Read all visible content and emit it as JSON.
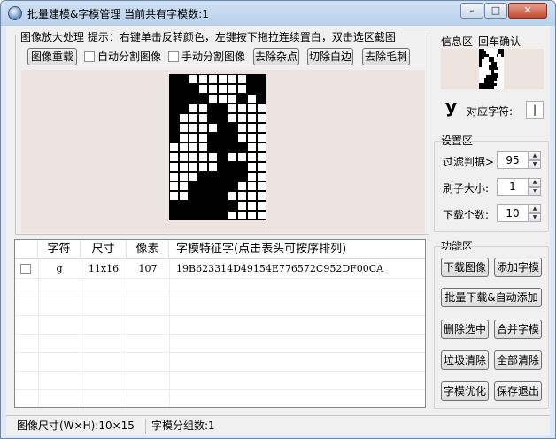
{
  "window": {
    "title": "批量建模&字模管理  当前共有字模数:1",
    "min_glyph": "–",
    "max_glyph": "□",
    "close_glyph": "✕"
  },
  "zoom": {
    "legend": "图像放大处理  提示：右键单击反转颜色，左键按下拖拉连续置白，双击选区截图",
    "reload_label": "图像重载",
    "auto_split_label": "自动分割图像",
    "manual_split_label": "手动分割图像",
    "remove_noise_label": "去除杂点",
    "cut_margin_label": "切除白边",
    "remove_burr_label": "去除毛刺",
    "bitmap": [
      "1100000011",
      "1110000011",
      "1111000101",
      "1100110000",
      "1000110000",
      "1000011000",
      "1000111000",
      "0000111100",
      "0000010000",
      "0000011100",
      "0001111100",
      "0011111000",
      "0011110000",
      "1111111000",
      "1111110000"
    ]
  },
  "table": {
    "headers": [
      "字符",
      "尺寸",
      "像素",
      "字模特征字(点击表头可按序排列)"
    ],
    "rows": [
      {
        "char": "g",
        "size": "11x16",
        "pixels": "107",
        "feature": "19B623314D49154E776572C952DF00CA"
      }
    ]
  },
  "status": {
    "image_size": "图像尺寸(W×H):10×15",
    "group_count": "字模分组数:1"
  },
  "info": {
    "legend": "信息区",
    "confirm_label": "回车确认",
    "recognized_char": "y",
    "match_label": "对应字符:",
    "match_value": "|"
  },
  "settings": {
    "legend": "设置区",
    "filter_label": "过滤判据>",
    "filter_value": "95",
    "brush_label": "刷子大小:",
    "brush_value": "1",
    "download_label": "下载个数:",
    "download_value": "10",
    "up_glyph": "▲",
    "down_glyph": "▼"
  },
  "actions": {
    "legend": "功能区",
    "download_image": "下载图像",
    "add_font": "添加字模",
    "batch_download": "批量下载&自动添加",
    "delete_selected": "删除选中",
    "merge_font": "合并字模",
    "trash_clear": "垃圾清除",
    "clear_all": "全部清除",
    "optimize_font": "字模优化",
    "save_exit": "保存退出"
  }
}
